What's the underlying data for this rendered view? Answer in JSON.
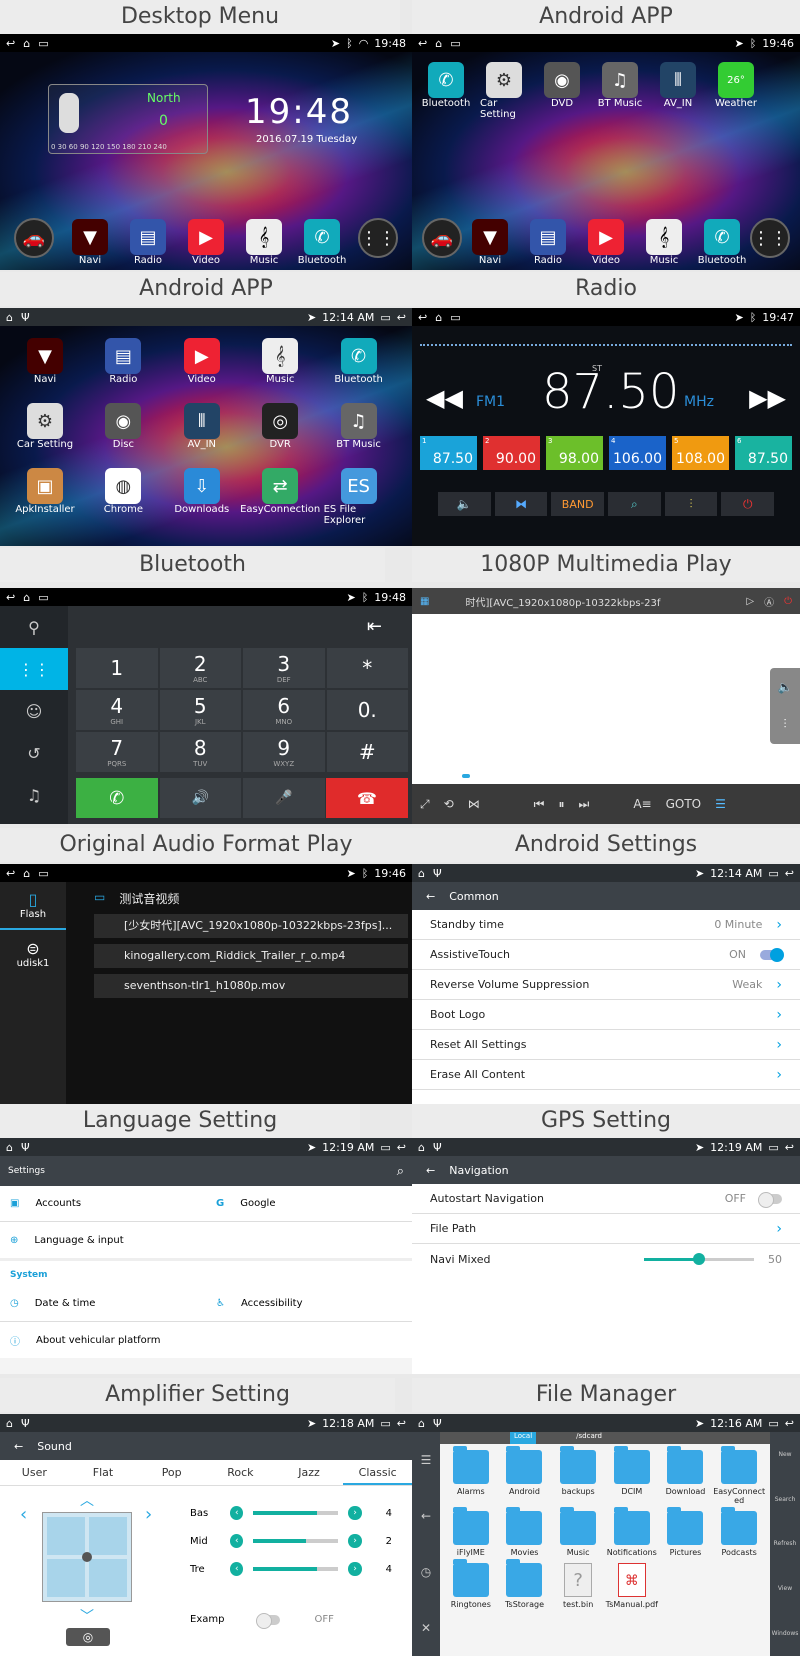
{
  "titles": [
    "Desktop Menu",
    "Android APP",
    "Android APP",
    "Radio",
    "Bluetooth",
    "1080P Multimedia Play",
    "Original Audio Format Play",
    "Android Settings",
    "Language Setting",
    "GPS Setting",
    "Amplifier Setting",
    "File Manager"
  ],
  "desktop": {
    "time_sb": "19:48",
    "direction": "North",
    "speed": "0",
    "speed_scale": "0 30 60 90 120 150 180 210 240",
    "clock": "19:48",
    "date": "2016.07.19 Tuesday",
    "dock": [
      "Navi",
      "Radio",
      "Video",
      "Music",
      "Bluetooth"
    ]
  },
  "apps1": {
    "time_sb": "19:46",
    "apps": [
      "Bluetooth",
      "Car Setting",
      "DVD",
      "BT Music",
      "AV_IN",
      "Weather"
    ],
    "weather_temp": "26°",
    "dock": [
      "Navi",
      "Radio",
      "Video",
      "Music",
      "Bluetooth"
    ]
  },
  "apps2": {
    "time_sb": "12:14 AM",
    "apps": [
      "Navi",
      "Radio",
      "Video",
      "Music",
      "Bluetooth",
      "Car Setting",
      "Disc",
      "AV_IN",
      "DVR",
      "BT Music",
      "ApkInstaller",
      "Chrome",
      "Downloads",
      "EasyConnection",
      "ES File Explorer"
    ]
  },
  "radio": {
    "time_sb": "19:47",
    "st": "ST",
    "band": "FM1",
    "freq": "87.50",
    "unit": "MHz",
    "presets": [
      {
        "n": "1",
        "f": "87.50",
        "c": "#1aa3d9"
      },
      {
        "n": "2",
        "f": "90.00",
        "c": "#e03030"
      },
      {
        "n": "3",
        "f": "98.00",
        "c": "#6cbf2a"
      },
      {
        "n": "4",
        "f": "106.00",
        "c": "#1a63c9"
      },
      {
        "n": "5",
        "f": "108.00",
        "c": "#f09a10"
      },
      {
        "n": "6",
        "f": "87.50",
        "c": "#19b3a0"
      }
    ],
    "band_btn": "BAND"
  },
  "bt": {
    "time_sb": "19:48",
    "keys": [
      [
        "1",
        ""
      ],
      [
        "2",
        "ABC"
      ],
      [
        "3",
        "DEF"
      ],
      [
        "*",
        ""
      ],
      [
        "4",
        "GHI"
      ],
      [
        "5",
        "JKL"
      ],
      [
        "6",
        "MNO"
      ],
      [
        "0.",
        ""
      ],
      [
        "7",
        "PQRS"
      ],
      [
        "8",
        "TUV"
      ],
      [
        "9",
        "WXYZ"
      ],
      [
        "#",
        ""
      ]
    ]
  },
  "video": {
    "file": "时代][AVC_1920x1080p-10322kbps-23f",
    "goto": "GOTO"
  },
  "audio": {
    "time_sb": "19:46",
    "folder": "测试音视频",
    "flash": "Flash",
    "udisk": "udisk1",
    "files": [
      "[少女时代][AVC_1920x1080p-10322kbps-23fps]...",
      "kinogallery.com_Riddick_Trailer_r_o.mp4",
      "seventhson-tlr1_h1080p.mov"
    ]
  },
  "settings": {
    "time_sb": "12:14 AM",
    "title": "Common",
    "rows": [
      {
        "l": "Standby time",
        "v": "0 Minute"
      },
      {
        "l": "AssistiveTouch",
        "v": "ON"
      },
      {
        "l": "Reverse Volume Suppression",
        "v": "Weak"
      },
      {
        "l": "Boot Logo",
        "v": ""
      },
      {
        "l": "Reset All Settings",
        "v": ""
      },
      {
        "l": "Erase All Content",
        "v": ""
      }
    ]
  },
  "lang": {
    "time_sb": "12:19 AM",
    "title": "Settings",
    "accounts": "Accounts",
    "google": "Google",
    "language": "Language & input",
    "system": "System",
    "date": "Date & time",
    "access": "Accessibility",
    "about": "About vehicular platform"
  },
  "gps": {
    "time_sb": "12:19 AM",
    "title": "Navigation",
    "autostart": "Autostart Navigation",
    "off": "OFF",
    "path": "File Path",
    "mixed": "Navi Mixed",
    "mixed_val": "50",
    "mixed_level": 0.5
  },
  "amp": {
    "time_sb": "12:18 AM",
    "title": "Sound",
    "tabs": [
      "User",
      "Flat",
      "Pop",
      "Rock",
      "Jazz",
      "Classic"
    ],
    "rows": [
      {
        "l": "Bas",
        "v": "4",
        "lvl": 0.75
      },
      {
        "l": "Mid",
        "v": "2",
        "lvl": 0.62
      },
      {
        "l": "Tre",
        "v": "4",
        "lvl": 0.75
      }
    ],
    "examp": "Examp",
    "examp_v": "OFF"
  },
  "fm": {
    "time_sb": "12:16 AM",
    "local": "Local",
    "path": "/sdcard",
    "items": [
      "Alarms",
      "Android",
      "backups",
      "DCIM",
      "Download",
      "EasyConnected",
      "iFlyIME",
      "Movies",
      "Music",
      "Notifications",
      "Pictures",
      "Podcasts",
      "Ringtones",
      "TsStorage",
      "test.bin",
      "TsManual.pdf"
    ],
    "side": [
      "New",
      "Search",
      "Refresh",
      "View",
      "Windows"
    ]
  }
}
